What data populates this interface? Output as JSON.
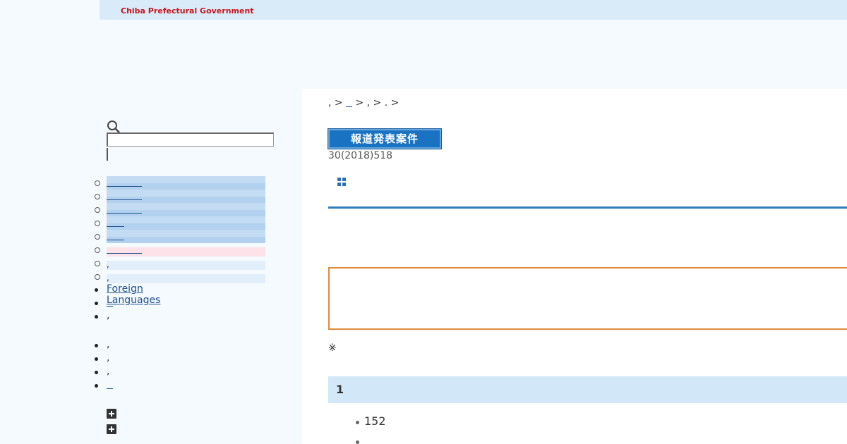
{
  "header": {
    "site_title": "Chiba Prefectural Government"
  },
  "nav": {
    "items": [
      {
        "label": "",
        "style": "blue",
        "underline_width": 50
      },
      {
        "label": "",
        "style": "blue",
        "underline_width": 50
      },
      {
        "label": "",
        "style": "blue",
        "underline_width": 50
      },
      {
        "label": "",
        "style": "blue",
        "underline_width": 25
      },
      {
        "label": "",
        "style": "blue",
        "underline_width": 25
      },
      {
        "label": "",
        "style": "pink",
        "underline_width": 50
      },
      {
        "label": ",",
        "style": "light",
        "underline_width": 0
      },
      {
        "label": ",",
        "style": "light",
        "underline_width": 0
      }
    ]
  },
  "links": {
    "foreign_languages": "Foreign Languages",
    "second": "  ",
    "third": ","
  },
  "sublinks": [
    ",",
    ",",
    ",",
    "  "
  ],
  "breadcrumb": {
    "items": [
      ",",
      "  ",
      ",",
      "."
    ],
    "separator": " > "
  },
  "article": {
    "badge": "報道発表案件",
    "date": "30(2018)518",
    "note": "※",
    "section_number": "1",
    "bullets": [
      "152",
      ""
    ]
  },
  "colors": {
    "site_title": "#c8161d",
    "accent_blue": "#2e7cc0",
    "notice_border": "#e08a3a",
    "section_bg": "#d2e7f7"
  }
}
